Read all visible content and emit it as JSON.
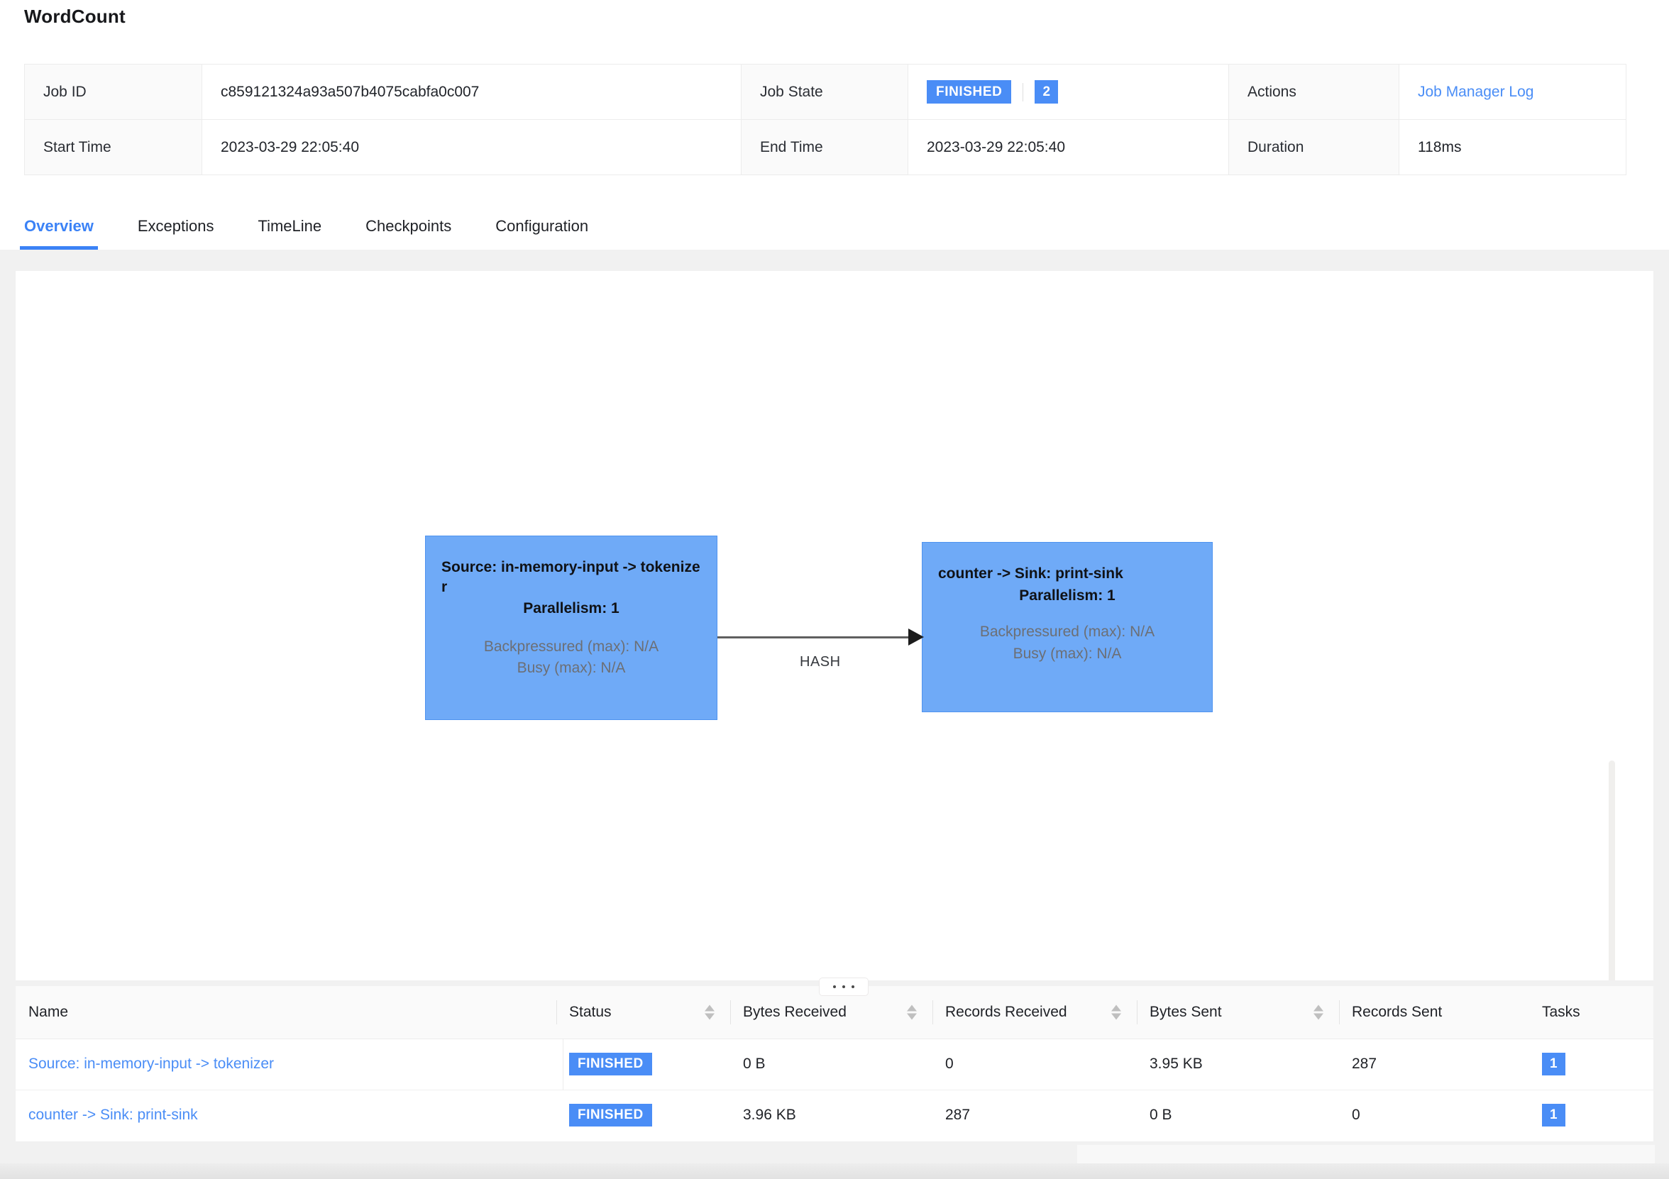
{
  "header": {
    "job_title": "WordCount"
  },
  "info": {
    "job_id_label": "Job ID",
    "job_id_value": "c859121324a93a507b4075cabfa0c007",
    "job_state_label": "Job State",
    "job_state_value": "FINISHED",
    "job_state_count": "2",
    "actions_label": "Actions",
    "actions_link": "Job Manager Log",
    "start_time_label": "Start Time",
    "start_time_value": "2023-03-29 22:05:40",
    "end_time_label": "End Time",
    "end_time_value": "2023-03-29 22:05:40",
    "duration_label": "Duration",
    "duration_value": "118ms"
  },
  "tabs": [
    {
      "label": "Overview",
      "active": true
    },
    {
      "label": "Exceptions",
      "active": false
    },
    {
      "label": "TimeLine",
      "active": false
    },
    {
      "label": "Checkpoints",
      "active": false
    },
    {
      "label": "Configuration",
      "active": false
    }
  ],
  "graph": {
    "nodes": [
      {
        "name": "Source: in-memory-input -> tokenizer",
        "parallelism": "Parallelism: 1",
        "backpressured": "Backpressured (max): N/A",
        "busy": "Busy (max): N/A"
      },
      {
        "name": "counter -> Sink: print-sink",
        "parallelism": "Parallelism: 1",
        "backpressured": "Backpressured (max): N/A",
        "busy": "Busy (max): N/A"
      }
    ],
    "edge_label": "HASH"
  },
  "table": {
    "columns": [
      "Name",
      "Status",
      "Bytes Received",
      "Records Received",
      "Bytes Sent",
      "Records Sent",
      "Tasks"
    ],
    "rows": [
      {
        "name": "Source: in-memory-input -> tokenizer",
        "status": "FINISHED",
        "bytes_received": "0 B",
        "records_received": "0",
        "bytes_sent": "3.95 KB",
        "records_sent": "287",
        "tasks": "1"
      },
      {
        "name": "counter -> Sink: print-sink",
        "status": "FINISHED",
        "bytes_received": "3.96 KB",
        "records_received": "287",
        "bytes_sent": "0 B",
        "records_sent": "0",
        "tasks": "1"
      }
    ]
  },
  "colors": {
    "accent_blue": "#4a8df6",
    "node_blue": "#6faaf7",
    "link_blue": "#4a8df6",
    "body_bg": "#f1f1f1"
  }
}
